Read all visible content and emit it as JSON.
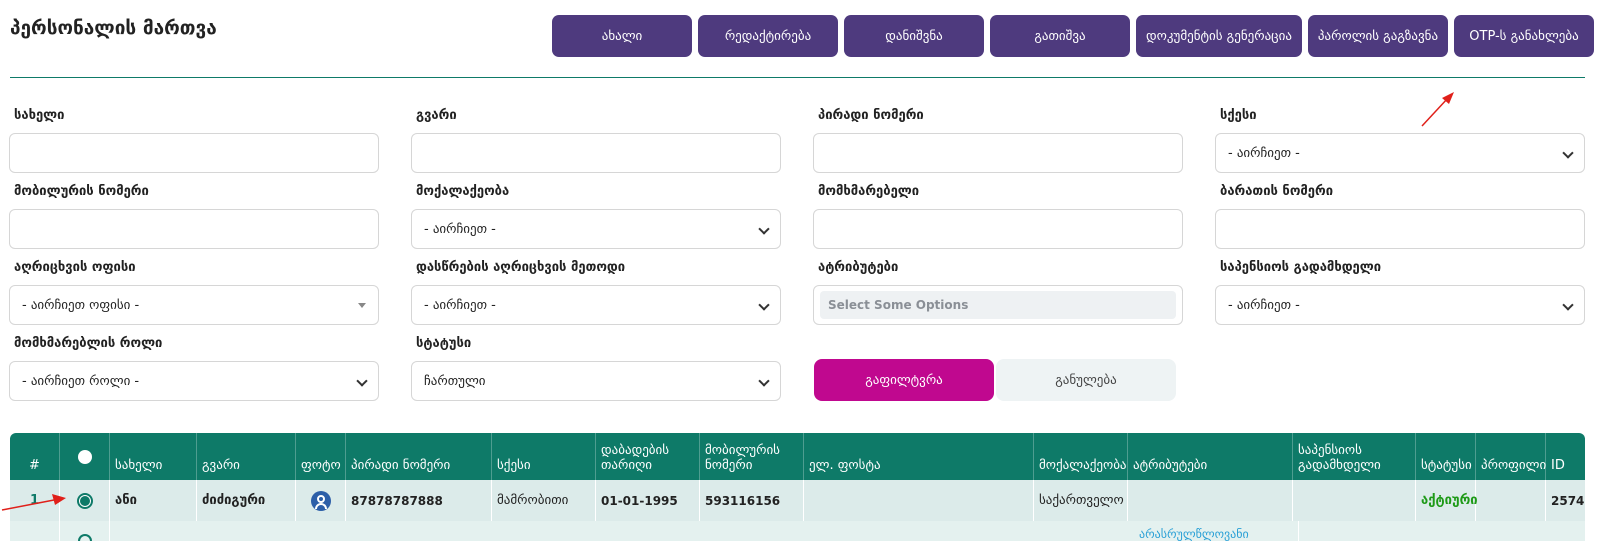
{
  "page": {
    "title": "პერსონალის მართვა"
  },
  "toolbar": {
    "buttons": [
      "ახალი",
      "რედაქტირება",
      "დანიშვნა",
      "გათიშვა",
      "დოკუმენტის გენერაცია",
      "პაროლის გაგზავნა",
      "OTP-ს განახლება"
    ]
  },
  "filters": {
    "first_name": {
      "label": "სახელი",
      "value": ""
    },
    "last_name": {
      "label": "გვარი",
      "value": ""
    },
    "personal_number": {
      "label": "პირადი ნომერი",
      "value": ""
    },
    "gender": {
      "label": "სქესი",
      "value": "- აირჩიეთ -"
    },
    "mobile": {
      "label": "მობილურის ნომერი",
      "value": ""
    },
    "citizenship": {
      "label": "მოქალაქეობა",
      "value": "- აირჩიეთ -"
    },
    "user": {
      "label": "მომხმარებელი",
      "value": ""
    },
    "card_number": {
      "label": "ბარათის ნომერი",
      "value": ""
    },
    "registration_office": {
      "label": "აღრიცხვის ოფისი",
      "value": "- აირჩიეთ ოფისი -"
    },
    "attendance_method": {
      "label": "დასწრების აღრიცხვის მეთოდი",
      "value": "- აირჩიეთ -"
    },
    "attributes": {
      "label": "ატრიბუტები",
      "placeholder": "Select Some Options"
    },
    "pension_payer": {
      "label": "საპენსიოს გადამხდელი",
      "value": "- აირჩიეთ -"
    },
    "user_role": {
      "label": "მომხმარებლის როლი",
      "value": "- აირჩიეთ როლი -"
    },
    "status": {
      "label": "სტატუსი",
      "value": "ჩართული"
    }
  },
  "actions": {
    "filter_label": "გაფილტვრა",
    "reset_label": "განულება"
  },
  "table": {
    "columns": {
      "num": "#",
      "first_name": "სახელი",
      "last_name": "გვარი",
      "photo": "ფოტო",
      "personal_number": "პირადი ნომერი",
      "gender": "სქესი",
      "birth_date": "დაბადების თარიღი",
      "mobile": "მობილურის ნომერი",
      "email": "ელ. ფოსტა",
      "citizenship": "მოქალაქეობა",
      "attributes": "ატრიბუტები",
      "pension_payer": "საპენსიოს გადამხდელი",
      "status": "სტატუსი",
      "profile": "პროფილი",
      "id": "ID"
    },
    "rows": [
      {
        "num": "1",
        "first_name": "ანი",
        "last_name": "ძიძიგური",
        "personal_number": "87878787888",
        "gender": "მამრობითი",
        "birth_date": "01-01-1995",
        "mobile": "593116156",
        "email": "",
        "citizenship": "საქართველო",
        "attributes": "",
        "pension_payer": "",
        "status": "აქტიური",
        "profile": "",
        "id": "2574"
      }
    ],
    "partial_row_text": "არასრულწლოვანი"
  },
  "colors": {
    "toolbar_button": "#4e3a7e",
    "table_header": "#0e7a68",
    "filter_button": "#c0088f",
    "status_active": "#1e9a17"
  }
}
